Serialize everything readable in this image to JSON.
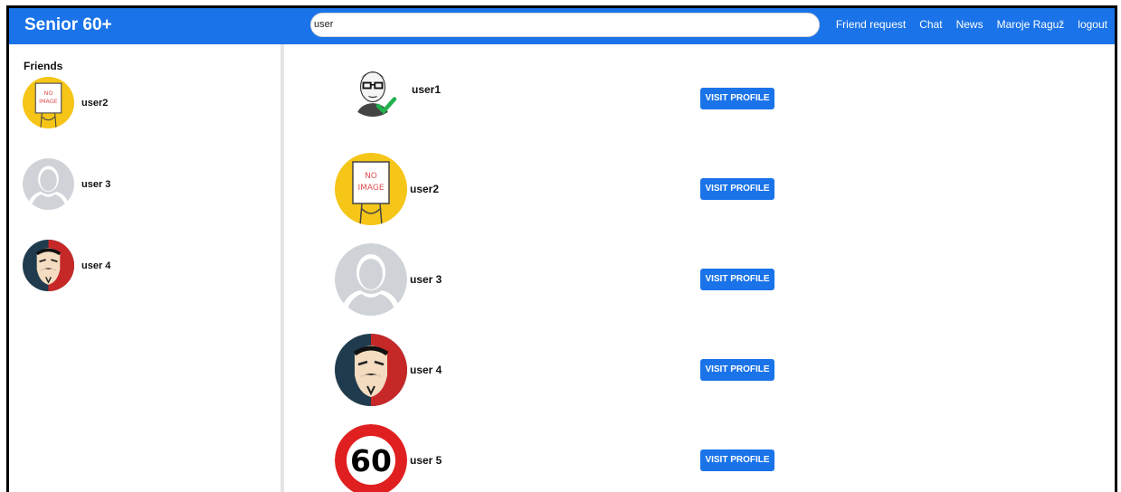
{
  "brand": "Senior 60+",
  "search": {
    "value": "user"
  },
  "nav": {
    "friend_request": "Friend request",
    "chat": "Chat",
    "news": "News",
    "user": "Maroje Raguž",
    "logout": "logout"
  },
  "sidebar": {
    "title": "Friends",
    "items": [
      {
        "label": "user2",
        "avatar": "no-image-avatar"
      },
      {
        "label": "user 3",
        "avatar": "placeholder-avatar"
      },
      {
        "label": "user 4",
        "avatar": "mask-avatar"
      }
    ]
  },
  "results": [
    {
      "label": "user1",
      "avatar": "glasses-avatar",
      "button": "VISIT PROFILE"
    },
    {
      "label": "user2",
      "avatar": "no-image-avatar",
      "button": "VISIT PROFILE"
    },
    {
      "label": "user 3",
      "avatar": "placeholder-avatar",
      "button": "VISIT PROFILE"
    },
    {
      "label": "user 4",
      "avatar": "mask-avatar",
      "button": "VISIT PROFILE"
    },
    {
      "label": "user 5",
      "avatar": "speed-sign-avatar",
      "button": "VISIT PROFILE",
      "sign_text": "60"
    }
  ],
  "no_image_text": [
    "NO",
    "IMAGE"
  ],
  "colors": {
    "accent": "#1a73e8",
    "no_image_bg": "#f5c518",
    "placeholder": "#cfd3d8",
    "sign_red": "#e02020"
  }
}
